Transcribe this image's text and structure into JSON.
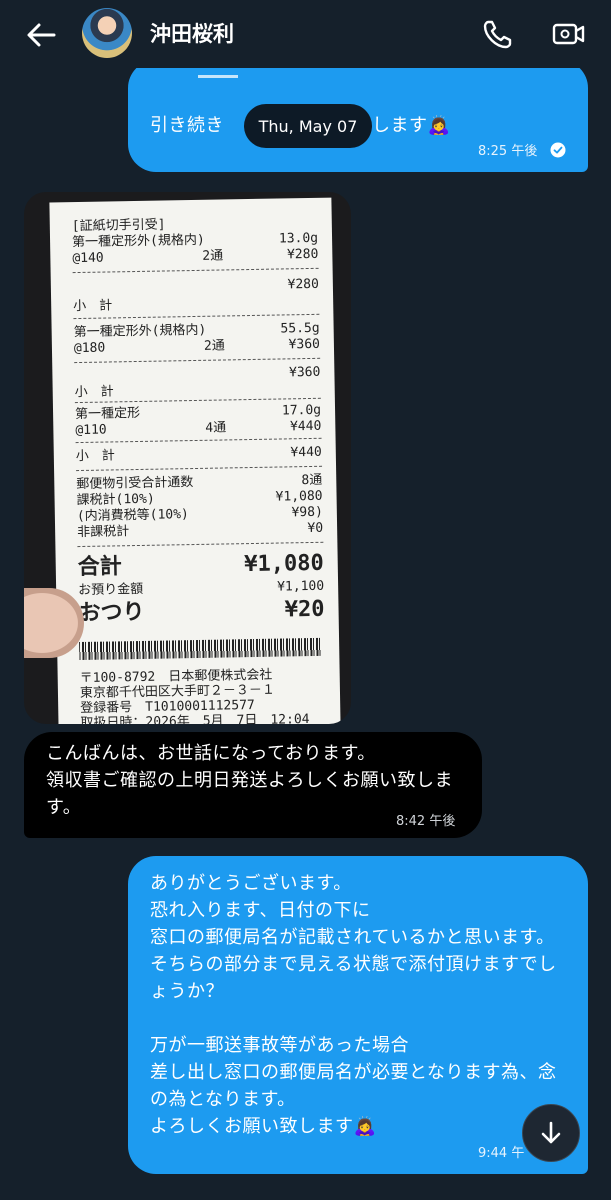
{
  "header": {
    "contact_name": "沖田桜利"
  },
  "date_chip": "Thu, May 07",
  "messages": {
    "m1": {
      "text": "引き続き　　　　　　　致します🙇‍♀️",
      "time": "8:25 午後"
    },
    "m2": {
      "text": "こんばんは、お世話になっております。\n領収書ご確認の上明日発送よろしくお願い致します。",
      "time": "8:42 午後"
    },
    "m3": {
      "text": "ありがとうございます。\n恐れ入ります、日付の下に\n窓口の郵便局名が記載されているかと思います。\nそちらの部分まで見える状態で添付頂けますでしょうか？\n\n万が一郵送事故等があった場合\n差し出し窓口の郵便局名が必要となります為、念の為となります。\nよろしくお願い致します🙇‍♀️",
      "time": "9:44 午"
    }
  },
  "receipt": {
    "header": "[証紙切手引受]",
    "rows": [
      {
        "label": "第一種定形外(規格内)",
        "mid": "",
        "value": "13.0g"
      },
      {
        "label": "@140",
        "mid": "2通",
        "value": "¥280"
      },
      {
        "label": "小　計",
        "mid": "",
        "value": "¥280"
      },
      {
        "label": "第一種定形外(規格内)",
        "mid": "",
        "value": "55.5g"
      },
      {
        "label": "@180",
        "mid": "2通",
        "value": "¥360"
      },
      {
        "label": "小　計",
        "mid": "",
        "value": "¥360"
      },
      {
        "label": "第一種定形",
        "mid": "",
        "value": "17.0g"
      },
      {
        "label": "@110",
        "mid": "4通",
        "value": "¥440"
      },
      {
        "label": "小　計",
        "mid": "",
        "value": "¥440"
      },
      {
        "label": "郵便物引受合計通数",
        "mid": "",
        "value": "8通"
      },
      {
        "label": "課税計(10%)",
        "mid": "",
        "value": "¥1,080"
      },
      {
        "label": "(内消費税等(10%)",
        "mid": "",
        "value": "¥98)"
      },
      {
        "label": "非課税計",
        "mid": "",
        "value": "¥0"
      }
    ],
    "total_label": "合計",
    "total_value": "¥1,080",
    "deposit_label": "お預り金額",
    "deposit_value": "¥1,100",
    "change_label": "おつり",
    "change_value": "¥20",
    "footer": [
      "〒100-8792　日本郵便株式会社",
      "東京都千代田区大手町２－３－１",
      "登録番号　T1010001112577",
      "取扱日時：2026年　5月　7日　12:04"
    ]
  },
  "colors": {
    "background": "#15202b",
    "outgoing_bubble": "#1d9bf0",
    "incoming_bubble": "#000000"
  },
  "icons": [
    "back-arrow-icon",
    "phone-icon",
    "video-call-icon",
    "read-check-icon",
    "arrow-down-icon"
  ]
}
